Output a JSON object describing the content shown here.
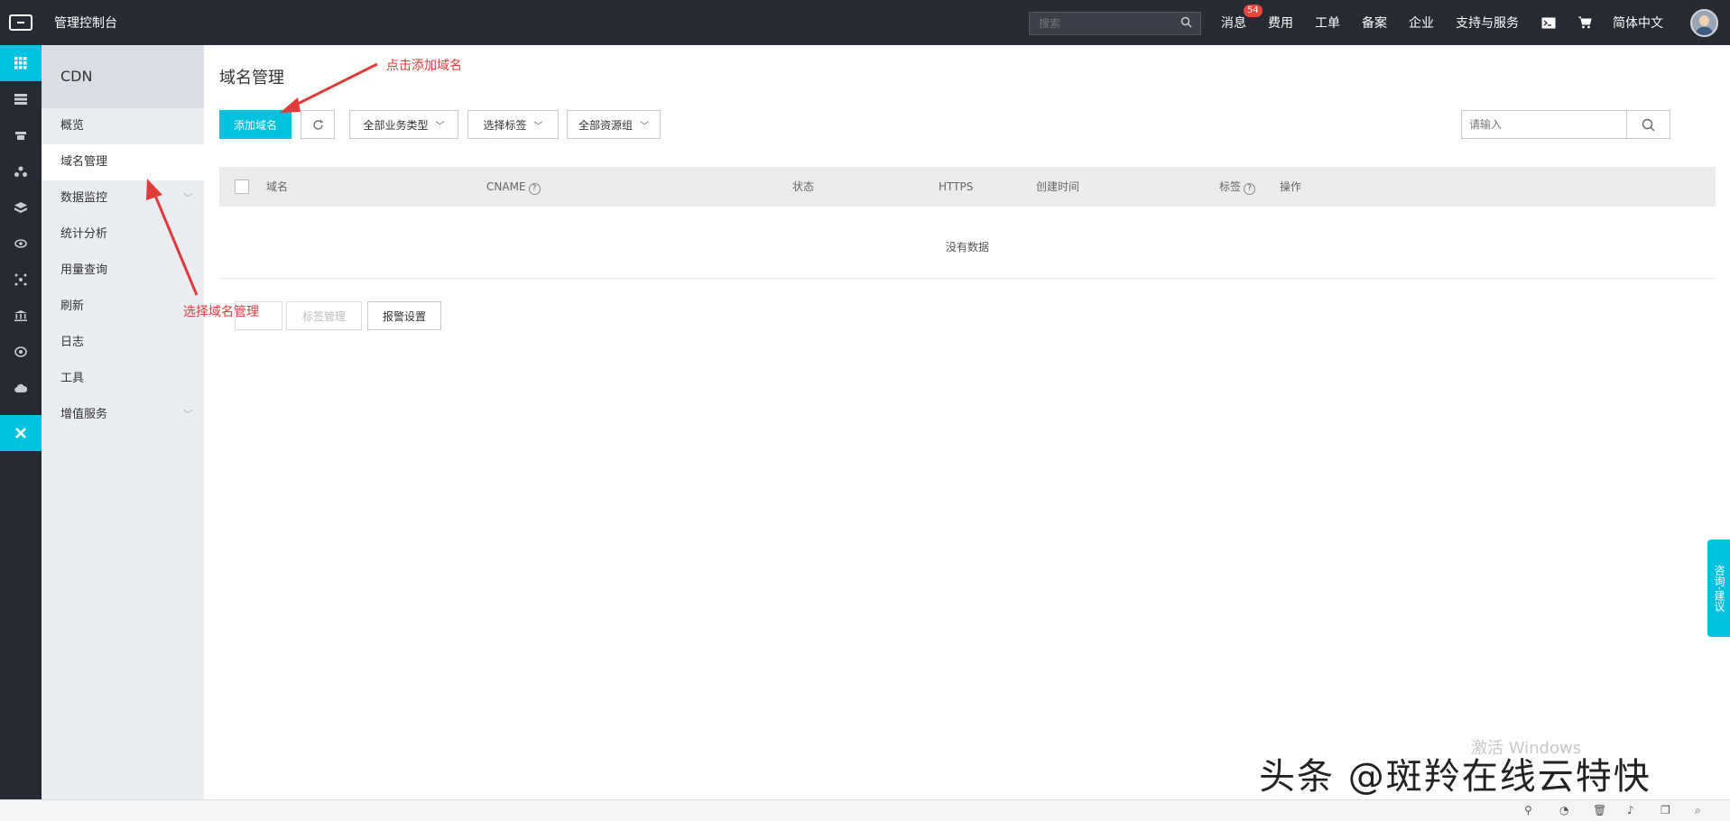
{
  "topbar": {
    "title": "管理控制台",
    "search_placeholder": "搜索",
    "nav": [
      "消息",
      "费用",
      "工单",
      "备案",
      "企业",
      "支持与服务"
    ],
    "message_badge": "54",
    "language": "简体中文"
  },
  "sidebar": {
    "title": "CDN",
    "items": [
      {
        "label": "概览"
      },
      {
        "label": "域名管理"
      },
      {
        "label": "数据监控"
      },
      {
        "label": "统计分析"
      },
      {
        "label": "用量查询"
      },
      {
        "label": "刷新"
      },
      {
        "label": "日志"
      },
      {
        "label": "工具"
      },
      {
        "label": "增值服务"
      }
    ]
  },
  "main": {
    "title": "域名管理",
    "add_domain": "添加域名",
    "dropdowns": [
      "全部业务类型",
      "选择标签",
      "全部资源组"
    ],
    "search_placeholder": "请输入",
    "columns": [
      "域名",
      "CNAME",
      "状态",
      "HTTPS",
      "创建时间",
      "标签",
      "操作"
    ],
    "empty_text": "没有数据",
    "bottom_buttons": [
      "标签管理",
      "报警设置"
    ]
  },
  "annotations": {
    "add_domain": "点击添加域名",
    "select_domain_mgmt": "选择域名管理"
  },
  "feedback": "咨询·建议",
  "windows_watermark": "激活 Windows",
  "source_watermark": "头条 @斑羚在线云特快",
  "colors": {
    "accent": "#00c1de",
    "topbar": "#262a33",
    "annotation": "#e03a3a"
  }
}
